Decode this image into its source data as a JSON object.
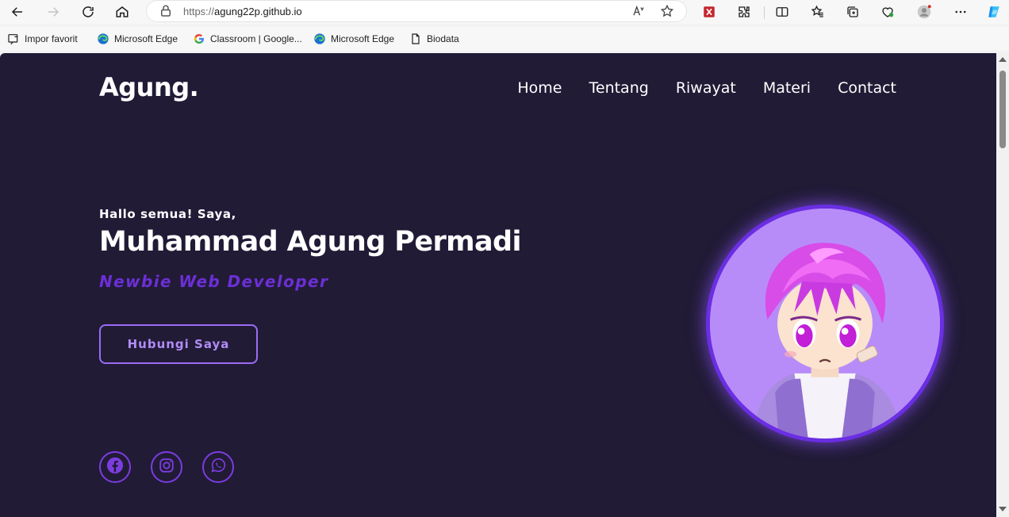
{
  "browser": {
    "url_protocol": "https://",
    "url_host": "agung22p.github.io",
    "bookmarks": [
      {
        "label": "Impor favorit",
        "icon": "import-favorites-icon"
      },
      {
        "label": "Microsoft Edge",
        "icon": "edge-icon"
      },
      {
        "label": "Classroom | Google...",
        "icon": "google-icon"
      },
      {
        "label": "Microsoft Edge",
        "icon": "edge-icon"
      },
      {
        "label": "Biodata",
        "icon": "document-icon"
      }
    ]
  },
  "site": {
    "logo": "Agung.",
    "nav": [
      "Home",
      "Tentang",
      "Riwayat",
      "Materi",
      "Contact"
    ],
    "greeting": "Hallo semua! Saya,",
    "name": "Muhammad Agung Permadi",
    "role": "Newbie Web Developer",
    "cta_label": "Hubungi Saya",
    "socials": [
      "facebook-icon",
      "instagram-icon",
      "whatsapp-icon"
    ]
  },
  "colors": {
    "page_bg": "#211b36",
    "accent": "#6c2fd6",
    "button_border": "#9b6cf5",
    "avatar_bg": "#b88cf8"
  }
}
